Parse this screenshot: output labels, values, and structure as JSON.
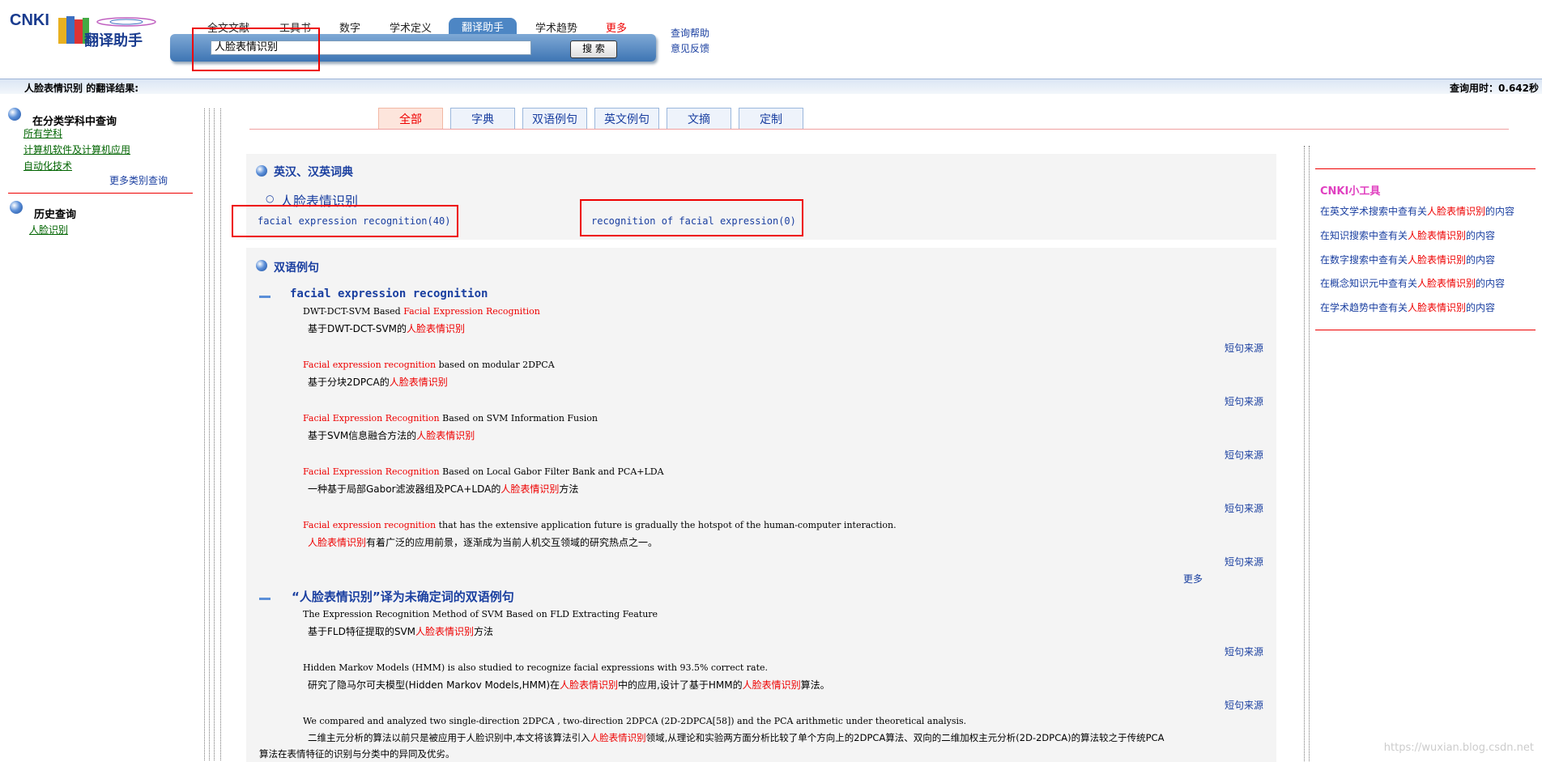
{
  "logo": {
    "brand": "CNKI",
    "title": "翻译助手"
  },
  "nav": {
    "tabs": [
      "全文文献",
      "工具书",
      "数字",
      "学术定义",
      "翻译助手",
      "学术趋势",
      "更多"
    ],
    "active": "翻译助手"
  },
  "search": {
    "value": "人脸表情识别",
    "button": "搜 索"
  },
  "toplinks": [
    "查询帮助",
    "意见反馈"
  ],
  "resultbar": {
    "query": "人脸表情识别",
    "suffix": " 的翻译结果:",
    "time": "查询用时：0.642秒"
  },
  "sidebar": {
    "category_heading": "在分类学科中查询",
    "categories": [
      "所有学科",
      "计算机软件及计算机应用",
      "自动化技术"
    ],
    "more_categories": "更多类别查询",
    "history_heading": "历史查询",
    "history": [
      "人脸识别"
    ]
  },
  "result_tabs": [
    "全部",
    "字典",
    "双语例句",
    "英文例句",
    "文摘",
    "定制"
  ],
  "dictionary": {
    "section_title": "英汉、汉英词典",
    "term": "人脸表情识别",
    "translations": [
      "facial expression recognition(40)",
      "recognition of facial expression(0)"
    ]
  },
  "bilingual": {
    "section_title": "双语例句",
    "group1_title": "facial expression recognition",
    "group1": [
      {
        "en_hl": "",
        "en_mid": "DWT-DCT-SVM Based ",
        "en_hl2": "Facial Expression Recognition",
        "en_rest": "",
        "cn_pre": "基于DWT-DCT-SVM的",
        "cn_hl": "人脸表情识别",
        "cn_post": ""
      },
      {
        "en_hl": "Facial expression recognition",
        "en_mid": "",
        "en_hl2": "",
        "en_rest": " based on modular 2DPCA",
        "cn_pre": "基于分块2DPCA的",
        "cn_hl": "人脸表情识别",
        "cn_post": ""
      },
      {
        "en_hl": "Facial Expression Recognition",
        "en_mid": "",
        "en_hl2": "",
        "en_rest": " Based on SVM Information Fusion",
        "cn_pre": "基于SVM信息融合方法的",
        "cn_hl": "人脸表情识别",
        "cn_post": ""
      },
      {
        "en_hl": "Facial Expression Recognition",
        "en_mid": "",
        "en_hl2": "",
        "en_rest": " Based on Local Gabor Filter Bank and PCA+LDA",
        "cn_pre": "一种基于局部Gabor滤波器组及PCA+LDA的",
        "cn_hl": "人脸表情识别",
        "cn_post": "方法"
      },
      {
        "en_hl": "Facial expression recognition",
        "en_mid": "",
        "en_hl2": "",
        "en_rest": " that has the extensive application future is gradually the hotspot of the human-computer interaction.",
        "cn_pre": "",
        "cn_hl": "人脸表情识别",
        "cn_post": "有着广泛的应用前景，逐渐成为当前人机交互领域的研究热点之一。"
      }
    ],
    "source_label": "短句来源",
    "more_label": "更多",
    "group2_title": "“人脸表情识别”译为未确定词的双语例句",
    "group2": [
      {
        "en": "The Expression Recognition Method of SVM Based on FLD Extracting Feature",
        "cn_pre": "基于FLD特征提取的SVM",
        "cn_hl": "人脸表情识别",
        "cn_post": "方法"
      },
      {
        "en": "Hidden Markov Models (HMM) is also studied to recognize facial expressions with 93.5% correct rate.",
        "cn_pre": "研究了隐马尔可夫模型(Hidden Markov Models,HMM)在",
        "cn_hl": "人脸表情识别",
        "cn_mid": "中的应用,设计了基于HMM的",
        "cn_hl2": "人脸表情识别",
        "cn_post": "算法。"
      },
      {
        "en": "We compared and analyzed two single-direction 2DPCA , two-direction 2DPCA (2D-2DPCA[58]) and the PCA arithmetic under theoretical analysis.",
        "cn_pre": "二维主元分析的算法以前只是被应用于人脸识别中,本文将该算法引入",
        "cn_hl": "人脸表情识别",
        "cn_post": "领域,从理论和实验两方面分析比较了单个方向上的2DPCA算法、双向的二维加权主元分析(2D-2DPCA)的算法较之于传统PCA",
        "cn_line2": "算法在表情特征的识别与分类中的异同及优劣。"
      }
    ]
  },
  "tools": {
    "title": "CNKI小工具",
    "items": [
      {
        "pre": "在英文学术搜索中查有关",
        "hl": "人脸表情识别",
        "post": "的内容"
      },
      {
        "pre": "在知识搜索中查有关",
        "hl": "人脸表情识别",
        "post": "的内容"
      },
      {
        "pre": "在数字搜索中查有关",
        "hl": "人脸表情识别",
        "post": "的内容"
      },
      {
        "pre": "在概念知识元中查有关",
        "hl": "人脸表情识别",
        "post": "的内容"
      },
      {
        "pre": "在学术趋势中查有关",
        "hl": "人脸表情识别",
        "post": "的内容"
      }
    ]
  },
  "watermark": "https://wuxian.blog.csdn.net",
  "colors": {
    "link": "#1a3fa0",
    "highlight": "#e00000",
    "green_link": "#006400"
  }
}
